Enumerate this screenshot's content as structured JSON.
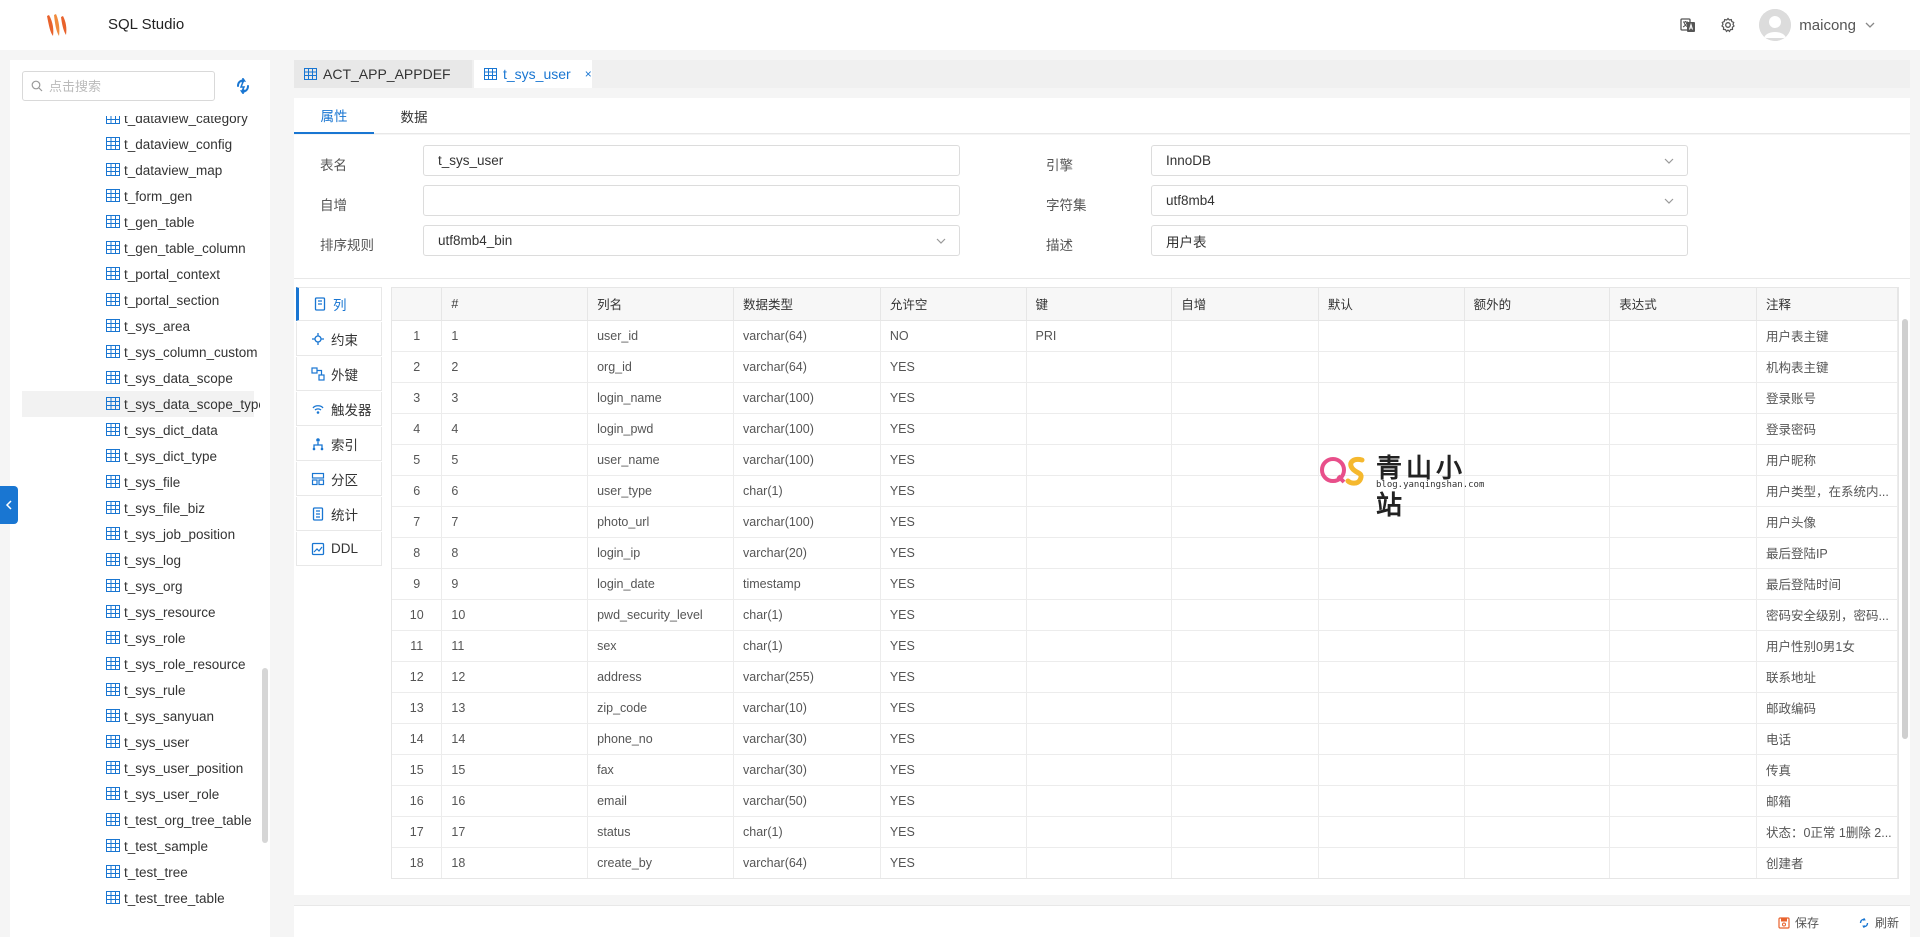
{
  "app": {
    "title": "SQL Studio",
    "username": "maicong"
  },
  "colors": {
    "accent": "#1976d2",
    "logo": "#e8622c"
  },
  "icons": {
    "logo": "logo-icon",
    "translate": "translate-icon",
    "settings": "gear-icon",
    "avatar": "avatar-icon",
    "dropdown": "chevron-down-icon",
    "search": "search-icon",
    "refresh": "refresh-icon",
    "table": "table-icon",
    "collapse": "chevron-left-icon"
  },
  "sidebar": {
    "search_placeholder": "点击搜索",
    "items": [
      {
        "label": "t_dataview_category"
      },
      {
        "label": "t_dataview_config"
      },
      {
        "label": "t_dataview_map"
      },
      {
        "label": "t_form_gen"
      },
      {
        "label": "t_gen_table"
      },
      {
        "label": "t_gen_table_column"
      },
      {
        "label": "t_portal_context"
      },
      {
        "label": "t_portal_section"
      },
      {
        "label": "t_sys_area"
      },
      {
        "label": "t_sys_column_custom"
      },
      {
        "label": "t_sys_data_scope"
      },
      {
        "label": "t_sys_data_scope_type"
      },
      {
        "label": "t_sys_dict_data"
      },
      {
        "label": "t_sys_dict_type"
      },
      {
        "label": "t_sys_file"
      },
      {
        "label": "t_sys_file_biz"
      },
      {
        "label": "t_sys_job_position"
      },
      {
        "label": "t_sys_log"
      },
      {
        "label": "t_sys_org"
      },
      {
        "label": "t_sys_resource"
      },
      {
        "label": "t_sys_role"
      },
      {
        "label": "t_sys_role_resource"
      },
      {
        "label": "t_sys_rule"
      },
      {
        "label": "t_sys_sanyuan"
      },
      {
        "label": "t_sys_user"
      },
      {
        "label": "t_sys_user_position"
      },
      {
        "label": "t_sys_user_role"
      },
      {
        "label": "t_test_org_tree_table"
      },
      {
        "label": "t_test_sample"
      },
      {
        "label": "t_test_tree"
      },
      {
        "label": "t_test_tree_table"
      }
    ],
    "selected": "t_sys_data_scope_type"
  },
  "doc_tabs": [
    {
      "label": "ACT_APP_APPDEF"
    },
    {
      "label": "t_sys_user",
      "close": "×"
    }
  ],
  "sub_tabs": [
    "属性",
    "数据"
  ],
  "props": {
    "table_name_label": "表名",
    "table_name": "t_sys_user",
    "auto_inc_label": "自增",
    "auto_inc": "",
    "collation_label": "排序规则",
    "collation": "utf8mb4_bin",
    "engine_label": "引擎",
    "engine": "InnoDB",
    "charset_label": "字符集",
    "charset": "utf8mb4",
    "desc_label": "描述",
    "desc": "用户表"
  },
  "side_tabs": [
    "列",
    "约束",
    "外键",
    "触发器",
    "索引",
    "分区",
    "统计",
    "DDL"
  ],
  "columns_table": {
    "headers": [
      "",
      "#",
      "列名",
      "数据类型",
      "允许空",
      "键",
      "自增",
      "默认",
      "额外的",
      "表达式",
      "注释"
    ],
    "rows": [
      [
        "1",
        "1",
        "user_id",
        "varchar(64)",
        "NO",
        "PRI",
        "",
        "",
        "",
        "",
        "用户表主键"
      ],
      [
        "2",
        "2",
        "org_id",
        "varchar(64)",
        "YES",
        "",
        "",
        "",
        "",
        "",
        "机构表主键"
      ],
      [
        "3",
        "3",
        "login_name",
        "varchar(100)",
        "YES",
        "",
        "",
        "",
        "",
        "",
        "登录账号"
      ],
      [
        "4",
        "4",
        "login_pwd",
        "varchar(100)",
        "YES",
        "",
        "",
        "",
        "",
        "",
        "登录密码"
      ],
      [
        "5",
        "5",
        "user_name",
        "varchar(100)",
        "YES",
        "",
        "",
        "",
        "",
        "",
        "用户昵称"
      ],
      [
        "6",
        "6",
        "user_type",
        "char(1)",
        "YES",
        "",
        "",
        "",
        "",
        "",
        "用户类型，在系统内..."
      ],
      [
        "7",
        "7",
        "photo_url",
        "varchar(100)",
        "YES",
        "",
        "",
        "",
        "",
        "",
        "用户头像"
      ],
      [
        "8",
        "8",
        "login_ip",
        "varchar(20)",
        "YES",
        "",
        "",
        "",
        "",
        "",
        "最后登陆IP"
      ],
      [
        "9",
        "9",
        "login_date",
        "timestamp",
        "YES",
        "",
        "",
        "",
        "",
        "",
        "最后登陆时间"
      ],
      [
        "10",
        "10",
        "pwd_security_level",
        "char(1)",
        "YES",
        "",
        "",
        "",
        "",
        "",
        "密码安全级别，密码..."
      ],
      [
        "11",
        "11",
        "sex",
        "char(1)",
        "YES",
        "",
        "",
        "",
        "",
        "",
        "用户性别0男1女"
      ],
      [
        "12",
        "12",
        "address",
        "varchar(255)",
        "YES",
        "",
        "",
        "",
        "",
        "",
        "联系地址"
      ],
      [
        "13",
        "13",
        "zip_code",
        "varchar(10)",
        "YES",
        "",
        "",
        "",
        "",
        "",
        "邮政编码"
      ],
      [
        "14",
        "14",
        "phone_no",
        "varchar(30)",
        "YES",
        "",
        "",
        "",
        "",
        "",
        "电话"
      ],
      [
        "15",
        "15",
        "fax",
        "varchar(30)",
        "YES",
        "",
        "",
        "",
        "",
        "",
        "传真"
      ],
      [
        "16",
        "16",
        "email",
        "varchar(50)",
        "YES",
        "",
        "",
        "",
        "",
        "",
        "邮箱"
      ],
      [
        "17",
        "17",
        "status",
        "char(1)",
        "YES",
        "",
        "",
        "",
        "",
        "",
        "状态：0正常 1删除 2..."
      ],
      [
        "18",
        "18",
        "create_by",
        "varchar(64)",
        "YES",
        "",
        "",
        "",
        "",
        "",
        "创建者"
      ]
    ]
  },
  "footer": {
    "save": "保存",
    "refresh": "刷新"
  },
  "watermark": {
    "title": "青山小站",
    "url": "blog.yanqingshan.com"
  }
}
